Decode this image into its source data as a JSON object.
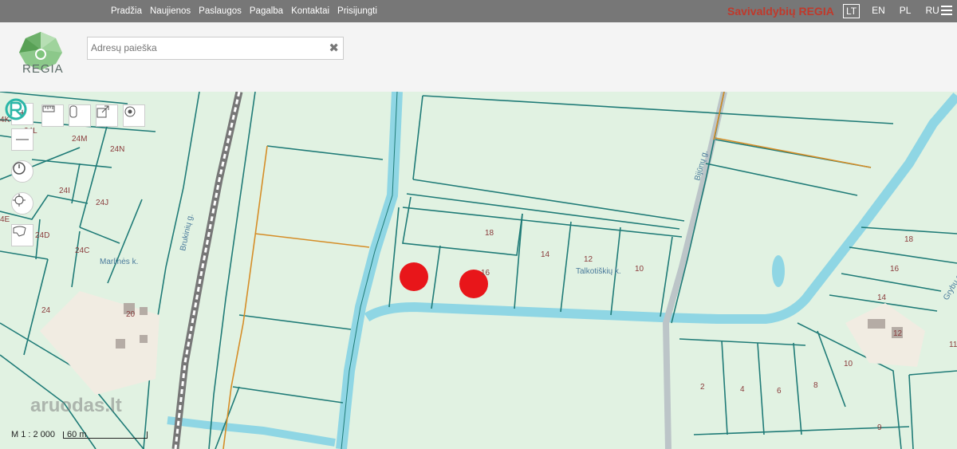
{
  "nav": {
    "links": [
      "Pradžia",
      "Naujienos",
      "Paslaugos",
      "Pagalba",
      "Kontaktai",
      "Prisijungti"
    ],
    "brand": "Savivaldybių REGIA",
    "languages": [
      "LT",
      "EN",
      "PL",
      "RU"
    ],
    "active_language": "LT"
  },
  "logo": {
    "text": "REGIA"
  },
  "search": {
    "placeholder": "Adresų paieška"
  },
  "map": {
    "scale_ratio": "M 1 : 2 000",
    "scale_bar": "60 m",
    "watermark": "aruodas.lt",
    "place_names": [
      "Marlinės k.",
      "Talkotiškių k."
    ],
    "street_names": [
      "Brukinių g.",
      "Bijūnų g.",
      "Grybų g."
    ],
    "parcel_numbers": [
      "4K",
      "24L",
      "24M",
      "24N",
      "24I",
      "24J",
      "4E",
      "24D",
      "24C",
      "24",
      "20",
      "18",
      "16",
      "14",
      "12",
      "10",
      "18",
      "16",
      "14",
      "12",
      "10",
      "11",
      "2",
      "4",
      "6",
      "8",
      "9"
    ],
    "marker_color": "#e8161a",
    "colors": {
      "parcel_line": "#1f7b77",
      "water": "#8fd6e4",
      "boundary": "#d58d27",
      "brand": "#c0392b"
    },
    "controls": [
      "zoom-in",
      "zoom-out",
      "measure",
      "mobile",
      "share",
      "locate",
      "history",
      "target",
      "draw"
    ]
  }
}
